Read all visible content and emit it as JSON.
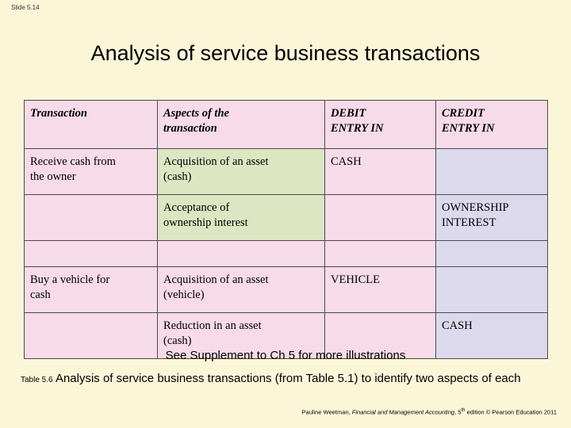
{
  "slide": {
    "number": "Slide 5.14",
    "title": "Analysis of service business transactions",
    "see_supplement": "See Supplement to Ch 5 for more illustrations"
  },
  "table": {
    "headers": [
      "Transaction",
      "Aspects of the transaction",
      "DEBIT ENTRY IN",
      "CREDIT ENTRY IN"
    ],
    "header_cells": {
      "h1": "Transaction",
      "h2_line1": "Aspects of the",
      "h2_line2": "transaction",
      "h3_line1": "DEBIT",
      "h3_line2": "ENTRY IN",
      "h4_line1": "CREDIT",
      "h4_line2": "ENTRY IN"
    },
    "rows": [
      {
        "transaction_line1": "Receive cash from",
        "transaction_line2": "the owner",
        "aspect_line1": "Acquisition of an asset",
        "aspect_line2": "(cash)",
        "debit": "CASH",
        "credit": ""
      },
      {
        "transaction_line1": "",
        "transaction_line2": "",
        "aspect_line1": "Acceptance of",
        "aspect_line2": "ownership interest",
        "debit": "",
        "credit_line1": "OWNERSHIP",
        "credit_line2": "INTEREST"
      },
      {
        "transaction_line1": "Buy a vehicle for",
        "transaction_line2": "cash",
        "aspect_line1": "Acquisition of an asset",
        "aspect_line2": "(vehicle)",
        "debit": "VEHICLE",
        "credit": ""
      },
      {
        "transaction_line1": "",
        "transaction_line2": "",
        "aspect_line1": "Reduction in an asset",
        "aspect_line2": "(cash)",
        "debit": "",
        "credit": "CASH"
      }
    ]
  },
  "caption": {
    "label": "Table 5.6",
    "text_line1": "Analysis of service business transactions (from Table 5.1) to identify two",
    "text_line2": "aspects of each"
  },
  "footer": {
    "author": "Pauline Weetman, ",
    "book": "Financial and Management Accounting",
    "edition": ", 5",
    "edition_sup": "th",
    "edition_rest": " edition © Pearson Education 2011"
  },
  "colors": {
    "background": "#fbf6d8",
    "pink": "#f7dbe8",
    "green": "#dde6c2",
    "violet": "#dcd9ed",
    "border": "#4a4a4a"
  }
}
